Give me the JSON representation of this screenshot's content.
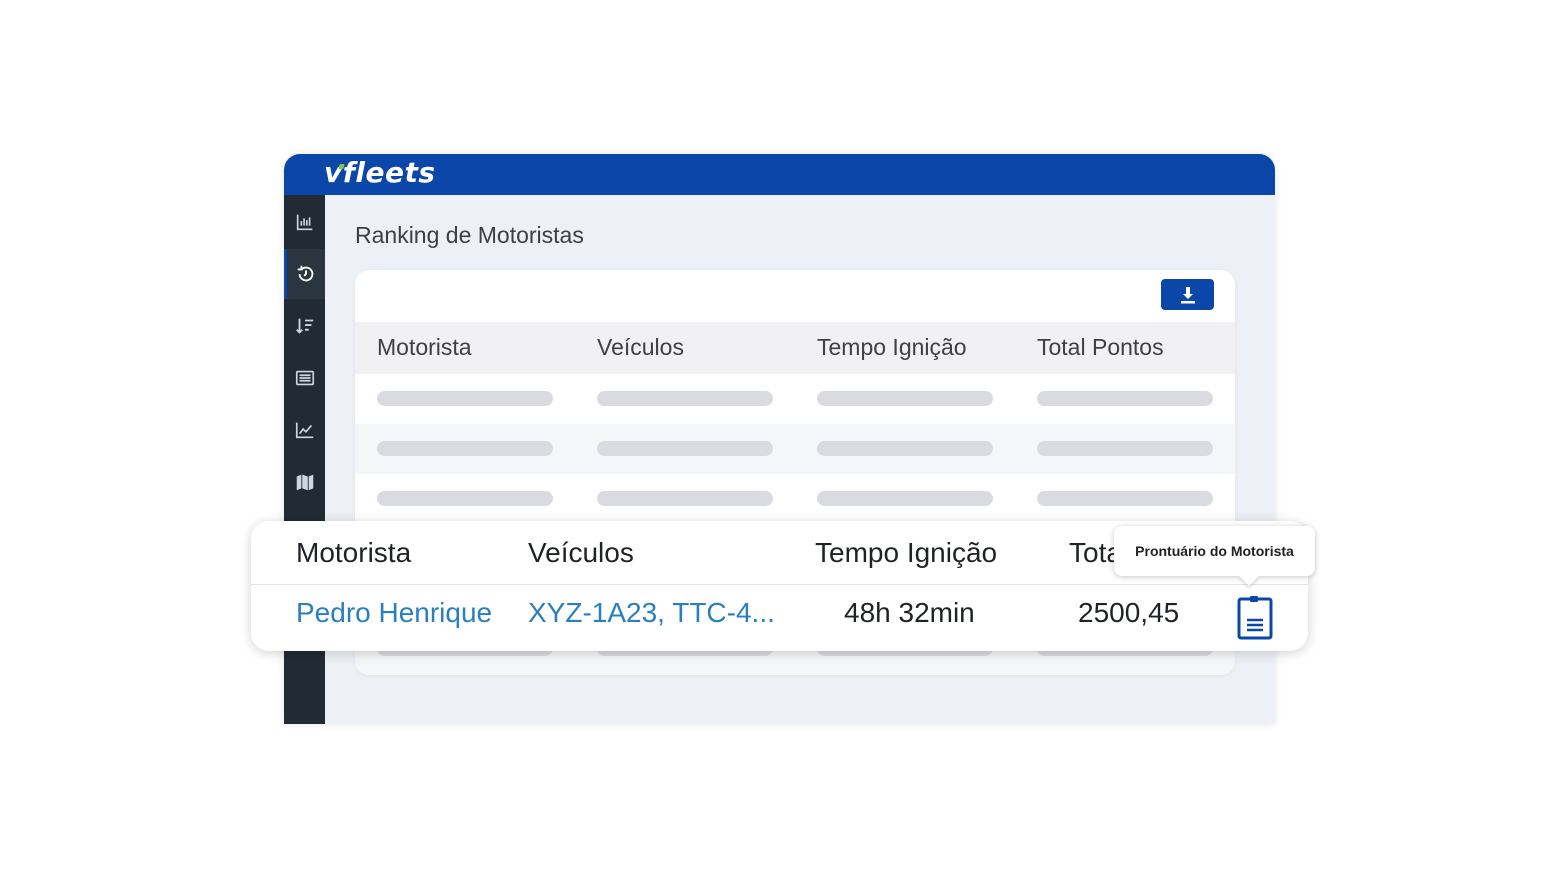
{
  "app": {
    "logo_text": "vfleets",
    "brand_color": "#0b47a8",
    "accent_color": "#8bc34a"
  },
  "sidebar": {
    "items": [
      {
        "icon": "bar-chart-icon",
        "active": false
      },
      {
        "icon": "history-icon",
        "active": true
      },
      {
        "icon": "sort-icon",
        "active": false
      },
      {
        "icon": "list-icon",
        "active": false
      },
      {
        "icon": "line-chart-icon",
        "active": false
      },
      {
        "icon": "map-icon",
        "active": false
      }
    ]
  },
  "main": {
    "title": "Ranking de Motoristas",
    "download_icon": "download-icon",
    "table": {
      "headers": [
        "Motorista",
        "Veículos",
        "Tempo Ignição",
        "Total Pontos"
      ]
    }
  },
  "popup": {
    "headers": [
      "Motorista",
      "Veículos",
      "Tempo Ignição",
      "Tota"
    ],
    "row": {
      "motorista": "Pedro Henrique",
      "veiculos": "XYZ-1A23, TTC-4...",
      "tempo_ignicao": "48h 32min",
      "total": "2500,45"
    },
    "tooltip": "Prontuário do Motorista",
    "action_icon": "clipboard-icon"
  }
}
